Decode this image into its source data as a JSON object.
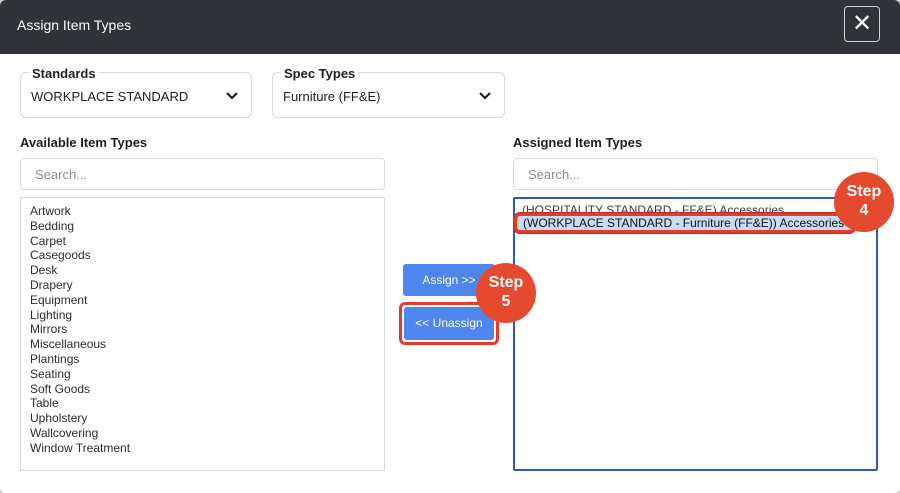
{
  "modal": {
    "title": "Assign Item Types",
    "close_icon": "close-icon"
  },
  "standards": {
    "label": "Standards",
    "value": "WORKPLACE STANDARD"
  },
  "spec_types": {
    "label": "Spec Types",
    "value": "Furniture (FF&E)"
  },
  "available": {
    "label": "Available Item Types",
    "search_placeholder": "Search...",
    "items": [
      "Artwork",
      "Bedding",
      "Carpet",
      "Casegoods",
      "Desk",
      "Drapery",
      "Equipment",
      "Lighting",
      "Mirrors",
      "Miscellaneous",
      "Plantings",
      "Seating",
      "Soft Goods",
      "Table",
      "Upholstery",
      "Wallcovering",
      "Window Treatment"
    ]
  },
  "assigned": {
    "label": "Assigned Item Types",
    "search_placeholder": "Search...",
    "items": [
      "(HOSPITALITY STANDARD - FF&E) Accessories",
      "(WORKPLACE STANDARD - Furniture (FF&E)) Accessories"
    ]
  },
  "buttons": {
    "assign": "Assign >>",
    "unassign": "<< Unassign"
  },
  "steps": {
    "step4": {
      "line1": "Step",
      "line2": "4"
    },
    "step5": {
      "line1": "Step",
      "line2": "5"
    }
  },
  "colors": {
    "header_bg": "#2f3236",
    "button_blue": "#4f86ee",
    "step_red": "#e64a2e",
    "highlight_outline": "#e53a2c",
    "selected_bg": "#c9dcf6"
  }
}
